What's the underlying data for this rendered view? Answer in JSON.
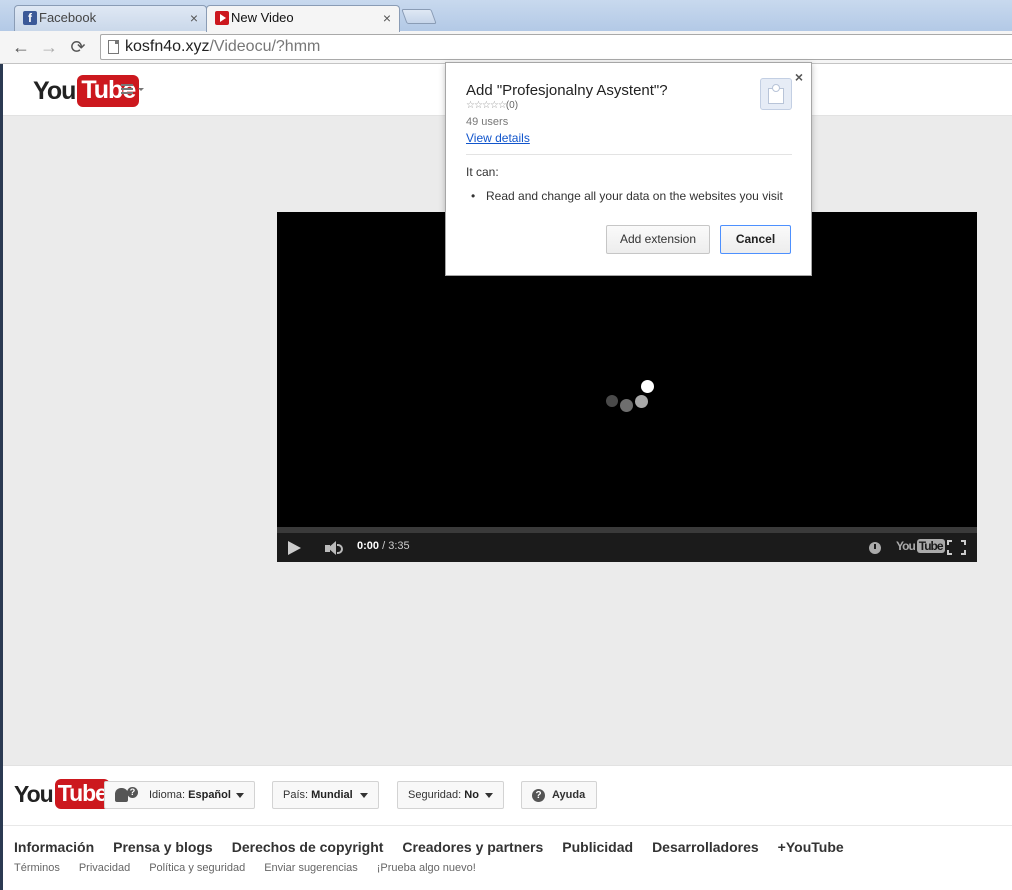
{
  "browser": {
    "tabs": [
      {
        "title": "Facebook",
        "icon": "facebook-icon",
        "icon_letter": "f",
        "close": "×"
      },
      {
        "title": "New Video",
        "icon": "youtube-icon",
        "close": "×"
      }
    ],
    "url_host": "kosfn4o.xyz",
    "url_path": "/Videocu/?hmm",
    "nav": {
      "back": "←",
      "forward": "→",
      "reload": "⟳"
    }
  },
  "youtube": {
    "logo_you": "You",
    "logo_tube": "Tube"
  },
  "player": {
    "current_time": "0:00",
    "separator": " / ",
    "duration": "3:35",
    "logo_you": "You",
    "logo_tube": "Tube",
    "spinner_colors": [
      "#4a4a4a",
      "#6e6e6e",
      "#a8a8a8",
      "#ffffff"
    ]
  },
  "dialog": {
    "close": "×",
    "title": "Add \"Profesjonalny Asystent\"?",
    "stars": "☆☆☆☆☆",
    "rating_count": "(0)",
    "users": "49 users",
    "view_details": "View details",
    "it_can": "It can:",
    "permissions": [
      "Read and change all your data on the websites you visit"
    ],
    "add_button": "Add extension",
    "cancel_button": "Cancel",
    "icon": "puzzle-piece-icon"
  },
  "footer": {
    "logo_you": "You",
    "logo_tube": "Tube",
    "language_label": "Idioma: ",
    "language_value": "Español",
    "country_label": "País: ",
    "country_value": "Mundial",
    "safety_label": "Seguridad: ",
    "safety_value": "No",
    "help_label": "Ayuda",
    "help_glyph": "?",
    "language_glyph": "?",
    "primary_links": [
      "Información",
      "Prensa y blogs",
      "Derechos de copyright",
      "Creadores y partners",
      "Publicidad",
      "Desarrolladores",
      "+YouTube"
    ],
    "secondary_links": [
      "Términos",
      "Privacidad",
      "Política y seguridad",
      "Enviar sugerencias",
      "¡Prueba algo nuevo!"
    ]
  },
  "colors": {
    "youtube_red": "#cc181e",
    "link_blue": "#1155cc",
    "focus_blue": "#4d90fe"
  }
}
